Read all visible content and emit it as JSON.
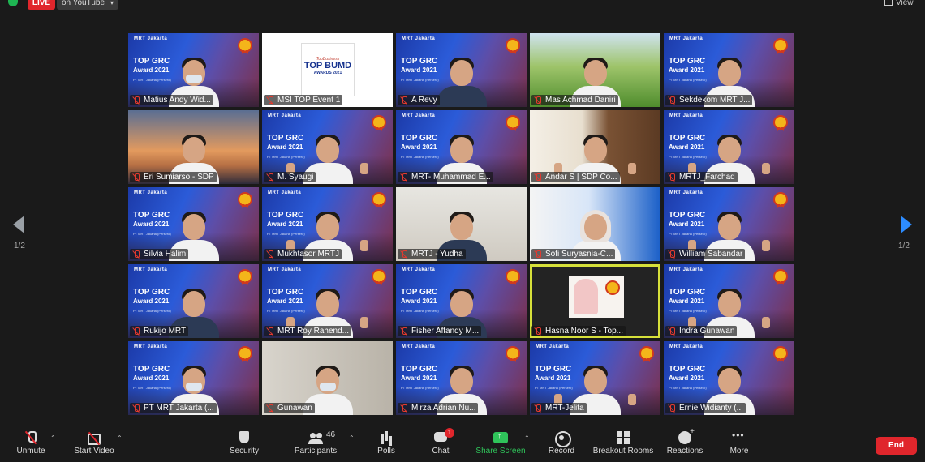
{
  "header": {
    "live_label": "LIVE",
    "stream_label": "on YouTube",
    "view_label": "View"
  },
  "pagination": {
    "left_page": "1/2",
    "right_page": "1/2"
  },
  "grc_background": {
    "logo_text": "MRT Jakarta",
    "line1": "TOP GRC",
    "line2": "Award 2021",
    "line3": "PT MRT Jakarta (Persero)"
  },
  "logo_tile": {
    "line1": "TopBusiness",
    "line2": "TOP BUMD",
    "line3": "AWARDS 2021"
  },
  "participants": [
    {
      "name": "Matius Andy Wid...",
      "bg": "grc",
      "person": "mask"
    },
    {
      "name": "MSI TOP Event 1",
      "bg": "logo",
      "person": "none"
    },
    {
      "name": "A Revy",
      "bg": "grc",
      "person": "dark"
    },
    {
      "name": "Mas Achmad Daniri",
      "bg": "garden",
      "person": "light"
    },
    {
      "name": "Sekdekom MRT J...",
      "bg": "grc",
      "person": "light"
    },
    {
      "name": "Eri Sumiarso - SDP",
      "bg": "bridge",
      "person": "light"
    },
    {
      "name": "M. Syaugi",
      "bg": "grc",
      "person": "thumbs"
    },
    {
      "name": "MRT- Muhammad E...",
      "bg": "grc",
      "person": "light"
    },
    {
      "name": "Andar S | SDP Co...",
      "bg": "library",
      "person": "thumbs"
    },
    {
      "name": "MRTJ_Farchad",
      "bg": "grc",
      "person": "thumbs"
    },
    {
      "name": "Silvia Halim",
      "bg": "grc",
      "person": "light"
    },
    {
      "name": "Mukhtasor MRTJ",
      "bg": "grc",
      "person": "thumbs"
    },
    {
      "name": "MRTJ - Yudha",
      "bg": "office",
      "person": "dark"
    },
    {
      "name": "Sofi Suryasnia-C...",
      "bg": "sofi",
      "person": "hijab"
    },
    {
      "name": "William Sabandar",
      "bg": "grc",
      "person": "thumbs"
    },
    {
      "name": "Rukijo MRT",
      "bg": "grc",
      "person": "dark"
    },
    {
      "name": "MRT Roy Rahend...",
      "bg": "grc",
      "person": "thumbs"
    },
    {
      "name": "Fisher Affandy M...",
      "bg": "grc",
      "person": "dark"
    },
    {
      "name": "Hasna Noor S - Top...",
      "bg": "dark",
      "person": "card"
    },
    {
      "name": "Indra Gunawan",
      "bg": "grc",
      "person": "thumbs"
    },
    {
      "name": "PT MRT Jakarta (...",
      "bg": "grc",
      "person": "mask"
    },
    {
      "name": "Gunawan",
      "bg": "room",
      "person": "mask"
    },
    {
      "name": "Mirza Adrian Nu...",
      "bg": "grc",
      "person": "light"
    },
    {
      "name": "MRT-Jelita",
      "bg": "grc",
      "person": "thumbs"
    },
    {
      "name": "Ernie Widianty (...",
      "bg": "grc",
      "person": "light"
    }
  ],
  "active_speaker_index": 18,
  "toolbar": {
    "unmute_label": "Unmute",
    "start_video_label": "Start Video",
    "security_label": "Security",
    "participants_label": "Participants",
    "participants_count": "46",
    "polls_label": "Polls",
    "chat_label": "Chat",
    "chat_badge": "1",
    "share_screen_label": "Share Screen",
    "record_label": "Record",
    "breakout_label": "Breakout Rooms",
    "reactions_label": "Reactions",
    "more_label": "More",
    "end_label": "End"
  },
  "colors": {
    "accent_blue": "#2d8cff",
    "share_green": "#2fc45a",
    "end_red": "#e0262c",
    "active_border": "#d6e03a"
  }
}
